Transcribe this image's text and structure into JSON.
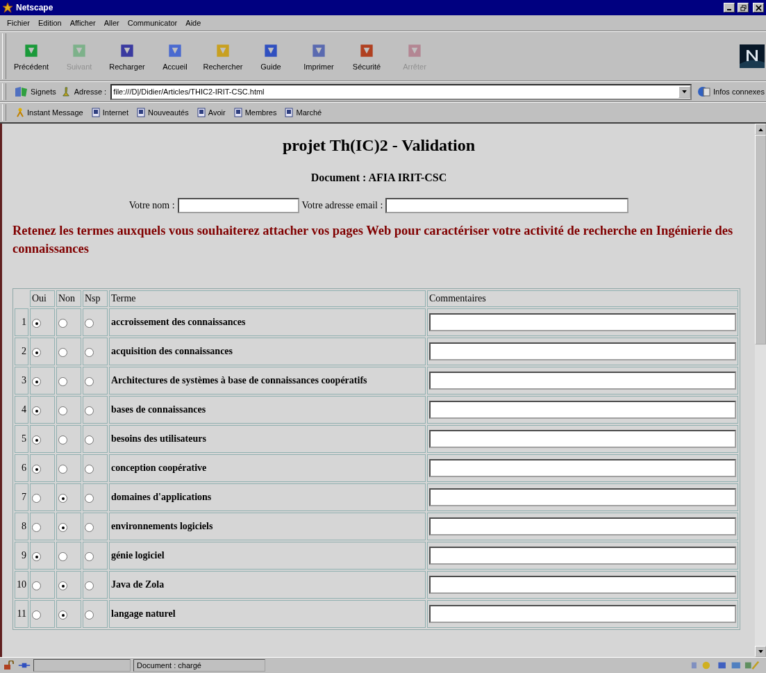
{
  "window": {
    "title": "Netscape"
  },
  "menu": [
    "Fichier",
    "Edition",
    "Afficher",
    "Aller",
    "Communicator",
    "Aide"
  ],
  "toolbar": [
    {
      "label": "Précédent",
      "disabled": false
    },
    {
      "label": "Suivant",
      "disabled": true
    },
    {
      "label": "Recharger",
      "disabled": false
    },
    {
      "label": "Accueil",
      "disabled": false
    },
    {
      "label": "Rechercher",
      "disabled": false
    },
    {
      "label": "Guide",
      "disabled": false
    },
    {
      "label": "Imprimer",
      "disabled": false
    },
    {
      "label": "Sécurité",
      "disabled": false
    },
    {
      "label": "Arrêter",
      "disabled": true
    }
  ],
  "location": {
    "bookmarks": "Signets",
    "label": "Adresse :",
    "value": "file:///D|/Didier/Articles/THIC2-IRIT-CSC.html",
    "related": "Infos connexes"
  },
  "personal_bar": [
    "Instant Message",
    "Internet",
    "Nouveautés",
    "Avoir",
    "Membres",
    "Marché"
  ],
  "page": {
    "title": "projet Th(IC)2 - Validation",
    "subtitle": "Document : AFIA IRIT-CSC",
    "name_label": "Votre nom :",
    "email_label": "Votre adresse email :",
    "instructions": "Retenez les termes auxquels vous souhaiterez attacher vos pages Web pour caractériser votre activité de recherche en Ingénierie des connaissances"
  },
  "table": {
    "columns": [
      "Oui",
      "Non",
      "Nsp",
      "Terme",
      "Commentaires"
    ],
    "rows": [
      {
        "number": "1",
        "term": "accroissement des connaissances",
        "answers": [
          {
            "selected": true
          },
          {
            "selected": false
          },
          {
            "selected": false
          }
        ]
      },
      {
        "number": "2",
        "term": "acquisition des connaissances",
        "answers": [
          {
            "selected": true
          },
          {
            "selected": false
          },
          {
            "selected": false
          }
        ]
      },
      {
        "number": "3",
        "term": "Architectures de systèmes à base de connaissances coopératifs",
        "answers": [
          {
            "selected": true
          },
          {
            "selected": false
          },
          {
            "selected": false
          }
        ]
      },
      {
        "number": "4",
        "term": "bases de connaissances",
        "answers": [
          {
            "selected": true
          },
          {
            "selected": false
          },
          {
            "selected": false
          }
        ]
      },
      {
        "number": "5",
        "term": "besoins des utilisateurs",
        "answers": [
          {
            "selected": true
          },
          {
            "selected": false
          },
          {
            "selected": false
          }
        ]
      },
      {
        "number": "6",
        "term": "conception coopérative",
        "answers": [
          {
            "selected": true
          },
          {
            "selected": false
          },
          {
            "selected": false
          }
        ]
      },
      {
        "number": "7",
        "term": "domaines d'applications",
        "answers": [
          {
            "selected": false
          },
          {
            "selected": true
          },
          {
            "selected": false
          }
        ]
      },
      {
        "number": "8",
        "term": "environnements logiciels",
        "answers": [
          {
            "selected": false
          },
          {
            "selected": true
          },
          {
            "selected": false
          }
        ]
      },
      {
        "number": "9",
        "term": "génie logiciel",
        "answers": [
          {
            "selected": true
          },
          {
            "selected": false
          },
          {
            "selected": false
          }
        ]
      },
      {
        "number": "10",
        "term": "Java de Zola",
        "answers": [
          {
            "selected": false
          },
          {
            "selected": true
          },
          {
            "selected": false
          }
        ]
      },
      {
        "number": "11",
        "term": "langage naturel",
        "answers": [
          {
            "selected": false
          },
          {
            "selected": true
          },
          {
            "selected": false
          }
        ]
      }
    ]
  },
  "status_bar": {
    "text": "Document : chargé"
  }
}
